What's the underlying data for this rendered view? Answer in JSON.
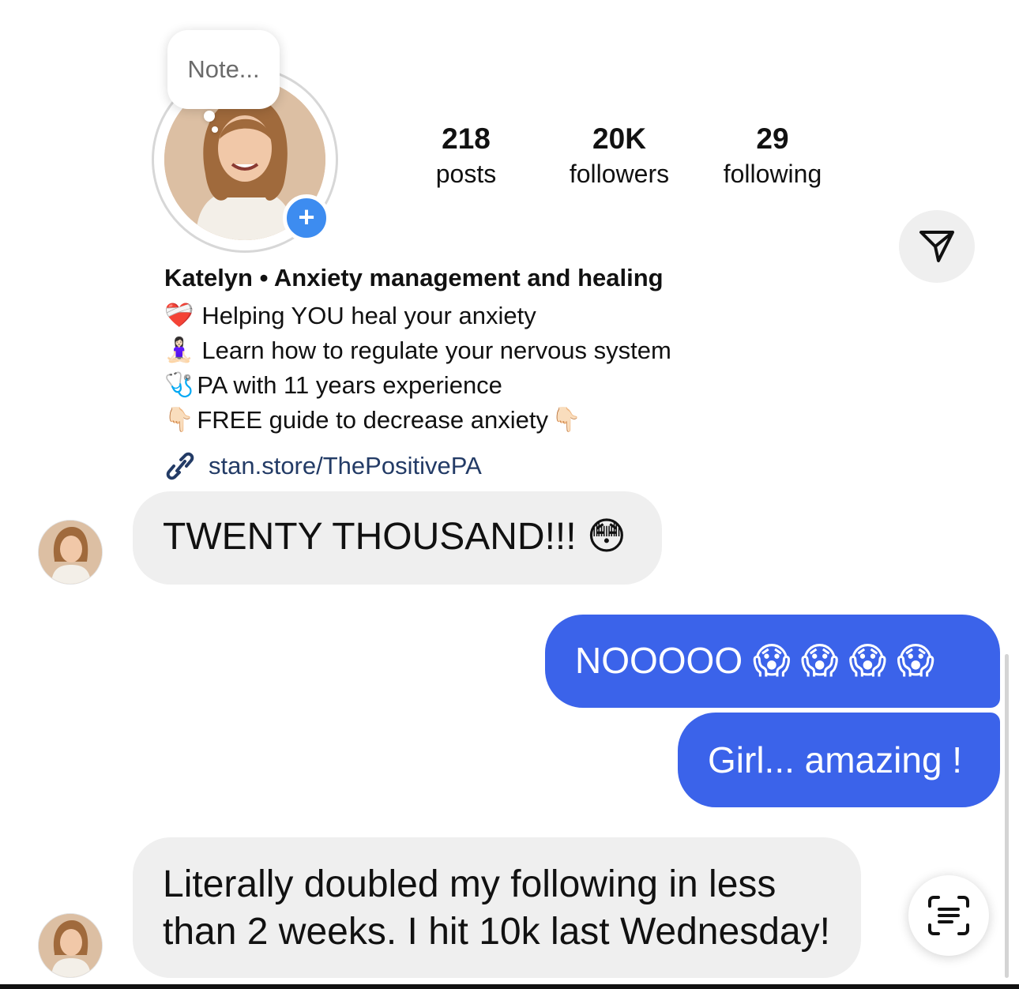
{
  "profile": {
    "note_placeholder": "Note...",
    "stats": [
      {
        "value": "218",
        "label": "posts"
      },
      {
        "value": "20K",
        "label": "followers"
      },
      {
        "value": "29",
        "label": "following"
      }
    ],
    "name_line": "Katelyn • Anxiety management and healing",
    "bio": [
      {
        "icon": "❤️‍🩹",
        "text": "Helping YOU heal your anxiety"
      },
      {
        "icon": "🧘🏻‍♀️",
        "text": "Learn how to regulate your nervous system"
      },
      {
        "icon": "🩺",
        "text": "PA with 11 years experience"
      },
      {
        "icon": "👇🏻",
        "text": "FREE guide to decrease anxiety",
        "trail_icon": "👇🏻"
      }
    ],
    "link": "stan.store/ThePositivePA"
  },
  "messages": [
    {
      "from": "them",
      "text": "TWENTY THOUSAND!!! 😳"
    },
    {
      "from": "me",
      "text": "NOOOOO 😱 😱 😱 😱"
    },
    {
      "from": "me",
      "text": "Girl... amazing !"
    },
    {
      "from": "them",
      "text": "Literally doubled my following in less than 2 weeks. I hit 10k last Wednesday!"
    }
  ],
  "icons": {
    "share": "paper-plane-icon",
    "add": "plus-icon",
    "link": "link-icon",
    "scan": "text-scan-icon"
  },
  "colors": {
    "outgoing_bubble": "#3b63ea",
    "incoming_bubble": "#efefef",
    "add_badge": "#3d8cf0",
    "link_text": "#233b66"
  }
}
